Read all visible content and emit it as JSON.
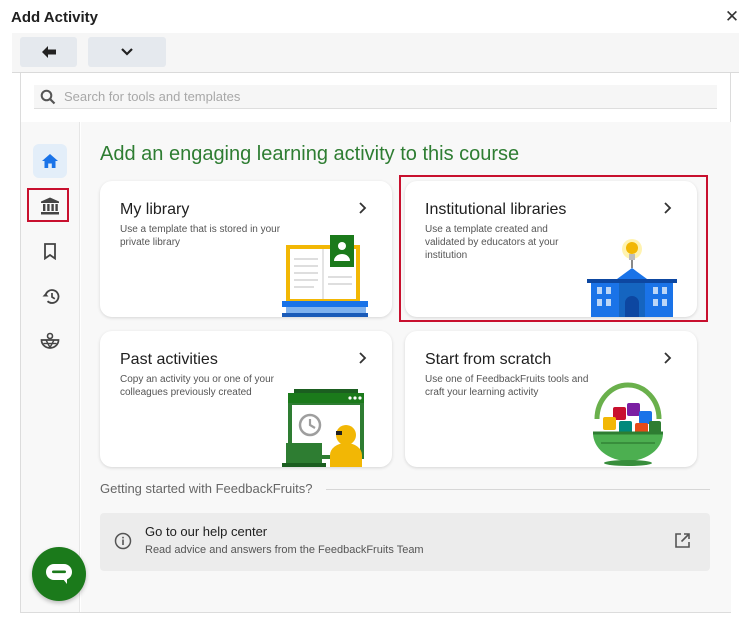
{
  "window": {
    "title": "Add Activity"
  },
  "search": {
    "placeholder": "Search for tools and templates"
  },
  "sidebar": {
    "items": [
      "home-icon",
      "institution-icon",
      "bookmark-icon",
      "history-icon",
      "basket-icon"
    ],
    "active": "home-icon",
    "highlighted": "institution-icon"
  },
  "main": {
    "heading": "Add an engaging learning activity to this course",
    "cards": [
      {
        "title": "My library",
        "description": "Use a template that is stored in your private library"
      },
      {
        "title": "Institutional libraries",
        "description": "Use a template created and validated by educators at your institution"
      },
      {
        "title": "Past activities",
        "description": "Copy an activity you or one of your colleagues previously created"
      },
      {
        "title": "Start from scratch",
        "description": "Use one of FeedbackFruits tools and craft your learning activity"
      }
    ],
    "getting_started": "Getting started with FeedbackFruits?",
    "help": {
      "title": "Go to our help center",
      "subtitle": "Read advice and answers from the FeedbackFruits Team"
    }
  },
  "colors": {
    "accent_green": "#2e7d32",
    "primary_blue": "#1a73e8",
    "highlight_red": "#c8102e",
    "chat_green": "#1b7a1b"
  }
}
